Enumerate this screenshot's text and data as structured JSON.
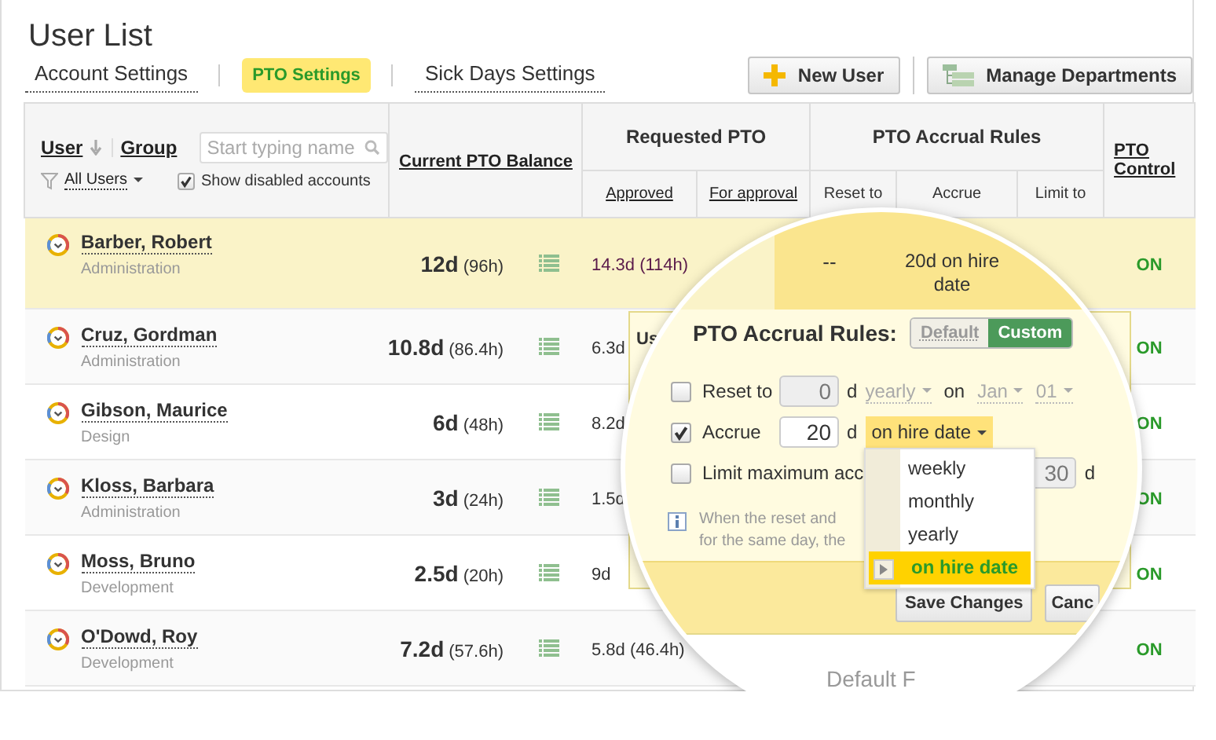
{
  "page": {
    "title": "User List"
  },
  "tabs": [
    {
      "label": "Account Settings",
      "selected": false
    },
    {
      "label": "PTO Settings",
      "selected": true
    },
    {
      "label": "Sick Days Settings",
      "selected": false
    }
  ],
  "toolbar_buttons": [
    {
      "label": "New User",
      "kind": "add"
    },
    {
      "label": "Manage Departments",
      "kind": "departments"
    }
  ],
  "table": {
    "user_header": {
      "sort_link": "User",
      "group_link": "Group",
      "search_placeholder": "Start typing name",
      "filter": "All Users",
      "show_disabled": {
        "label": "Show disabled accounts",
        "checked": true
      }
    },
    "balance_header": "Current PTO Balance",
    "requested_header": {
      "title": "Requested PTO",
      "columns": [
        "Approved",
        "For approval"
      ]
    },
    "accrual_header": {
      "title": "PTO Accrual Rules",
      "columns": [
        "Reset to",
        "Accrue",
        "Limit to"
      ]
    },
    "control_header": "PTO Control",
    "rows": [
      {
        "name": "Barber, Robert",
        "group": "Administration",
        "balance_days": "12d",
        "balance_hours": "(96h)",
        "approved": "14.3d (114h)",
        "pto_control": "ON",
        "selected": true
      },
      {
        "name": "Cruz, Gordman",
        "group": "Administration",
        "balance_days": "10.8d",
        "balance_hours": "(86.4h)",
        "approved": "6.3d",
        "pto_control": "ON",
        "selected": false
      },
      {
        "name": "Gibson, Maurice",
        "group": "Design",
        "balance_days": "6d",
        "balance_hours": "(48h)",
        "approved": "8.2d",
        "pto_control": "ON",
        "selected": false
      },
      {
        "name": "Kloss, Barbara",
        "group": "Administration",
        "balance_days": "3d",
        "balance_hours": "(24h)",
        "approved": "1.5d",
        "pto_control": "ON",
        "selected": false
      },
      {
        "name": "Moss, Bruno",
        "group": "Development",
        "balance_days": "2.5d",
        "balance_hours": "(20h)",
        "approved": "9d",
        "pto_control": "ON",
        "selected": false
      },
      {
        "name": "O'Dowd, Roy",
        "group": "Development",
        "balance_days": "7.2d",
        "balance_hours": "(57.6h)",
        "approved": "5.8d (46.4h)",
        "pto_control": "ON",
        "selected": false
      }
    ]
  },
  "popover_behind": {
    "title": "Us"
  },
  "magnifier": {
    "row": {
      "reset": "--",
      "accrue": "20d on hire date"
    },
    "popover": {
      "title": "PTO Accrual Rules:",
      "modes": [
        {
          "label": "Default",
          "selected": false
        },
        {
          "label": "Custom",
          "selected": true
        }
      ],
      "rules": [
        {
          "kind": "reset",
          "label": "Reset to",
          "checked": false,
          "value": "0",
          "unit": "d",
          "period": "yearly",
          "on": "on",
          "month": "Jan",
          "day": "01"
        },
        {
          "kind": "accrue",
          "label": "Accrue",
          "checked": true,
          "value": "20",
          "unit": "d",
          "period": "on hire date"
        },
        {
          "kind": "limit",
          "label": "Limit maximum acc",
          "checked": false,
          "value": "30",
          "unit": "d"
        }
      ],
      "note": [
        "When the reset and",
        "for the same day, the"
      ],
      "buttons": [
        "Save Changes",
        "Canc"
      ],
      "menu": [
        {
          "label": "weekly",
          "selected": false
        },
        {
          "label": "monthly",
          "selected": false
        },
        {
          "label": "yearly",
          "selected": false
        },
        {
          "label": "on hire date",
          "selected": true
        }
      ]
    },
    "footer_text": "Default F"
  }
}
